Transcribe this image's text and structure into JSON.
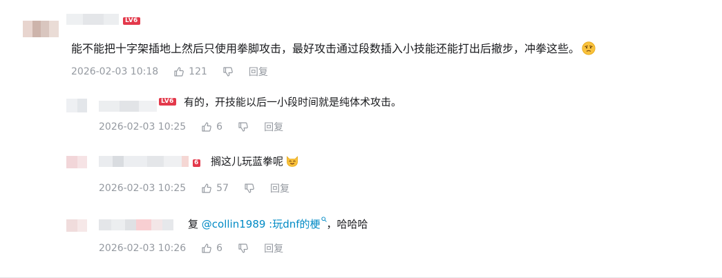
{
  "main_comment": {
    "level_badge": "LV6",
    "text": "能不能把十字架插地上然后只使用拳脚攻击，最好攻击通过段数插入小技能还能打出后撤步，冲拳这些。",
    "emoji_icon": "thinking-face-emoji",
    "time": "2026-02-03 10:18",
    "likes": "121",
    "reply_label": "回复"
  },
  "replies": [
    {
      "level_badge": "LV6",
      "text": "有的，开技能以后一小段时间就是纯体术攻击。",
      "time": "2026-02-03 10:25",
      "likes": "6",
      "reply_label": "回复"
    },
    {
      "level_badge": "6",
      "text": "搁这儿玩蓝拳呢",
      "emoji_icon": "cat-smile-emoji",
      "time": "2026-02-03 10:25",
      "likes": "57",
      "reply_label": "回复"
    },
    {
      "prefix": "复",
      "mention": "@collin1989",
      "separator": " :",
      "link_text": "玩dnf的梗",
      "suffix": "，哈哈哈",
      "time": "2026-02-03 10:26",
      "likes": "6",
      "reply_label": "回复"
    }
  ],
  "colors": {
    "level_badge": "#e3394b",
    "link": "#008ac5",
    "meta": "#9499a0",
    "text": "#18191c"
  }
}
